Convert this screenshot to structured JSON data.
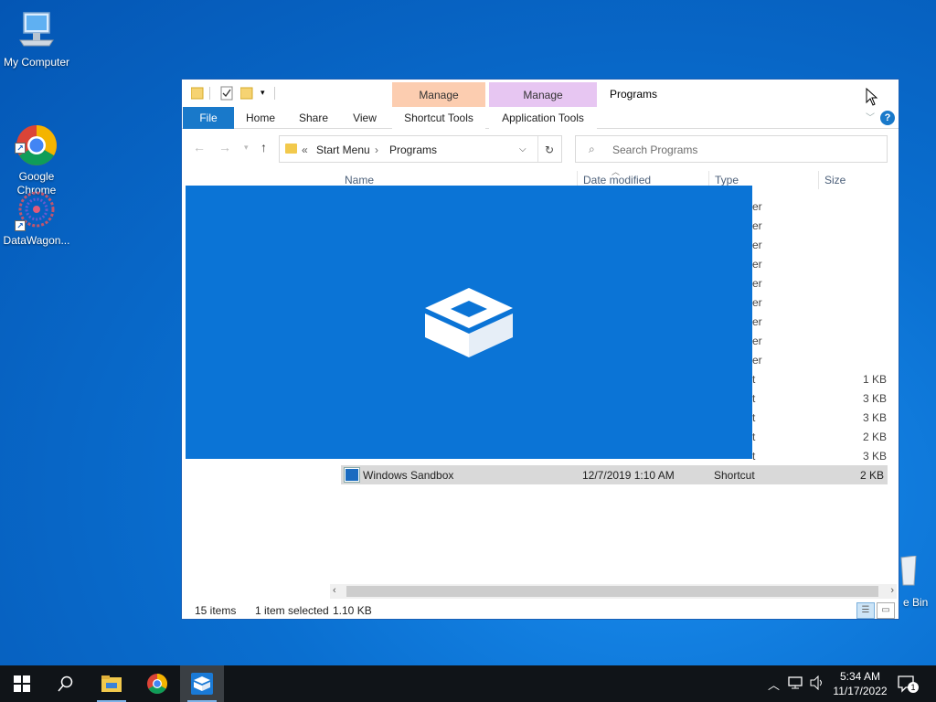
{
  "desktop": {
    "icons": [
      {
        "label": "My Computer",
        "icon": "computer-icon"
      },
      {
        "label": "Google\nChrome",
        "icon": "chrome-icon"
      },
      {
        "label": "DataWagon...",
        "icon": "datawagon-icon"
      }
    ],
    "recycle_bin_label": "e Bin"
  },
  "explorer": {
    "title": "Programs",
    "context_tabs": [
      {
        "group": "Manage",
        "tab": "Shortcut Tools",
        "color": "#fccdb0"
      },
      {
        "group": "Manage",
        "tab": "Application Tools",
        "color": "#e7c6f2"
      }
    ],
    "ribbon_tabs": [
      "File",
      "Home",
      "Share",
      "View"
    ],
    "address": {
      "overflow": "«",
      "crumbs": [
        "Start Menu",
        "Programs"
      ]
    },
    "search": {
      "placeholder": "Search Programs"
    },
    "columns": [
      "Name",
      "Date modified",
      "Type",
      "Size"
    ],
    "partial_type_text": [
      "er",
      "er",
      "er",
      "er",
      "er",
      "er",
      "er",
      "er",
      "er",
      "t",
      "t",
      "t",
      "t",
      "t"
    ],
    "partial_sizes": [
      "1 KB",
      "3 KB",
      "3 KB",
      "2 KB",
      "3 KB"
    ],
    "selected_row": {
      "name": "Windows Sandbox",
      "date": "12/7/2019 1:10 AM",
      "type": "Shortcut",
      "size": "2 KB"
    },
    "status": {
      "items": "15 items",
      "selected": "1 item selected",
      "size": "1.10 KB"
    }
  },
  "overlay": {
    "app": "Windows Sandbox",
    "icon": "sandbox-icon",
    "color": "#0b74d6"
  },
  "taskbar": {
    "apps": [
      "start-icon",
      "search-icon",
      "file-explorer-icon",
      "chrome-icon",
      "sandbox-icon"
    ],
    "clock_time": "5:34 AM",
    "clock_date": "11/17/2022",
    "notification_count": "1"
  }
}
